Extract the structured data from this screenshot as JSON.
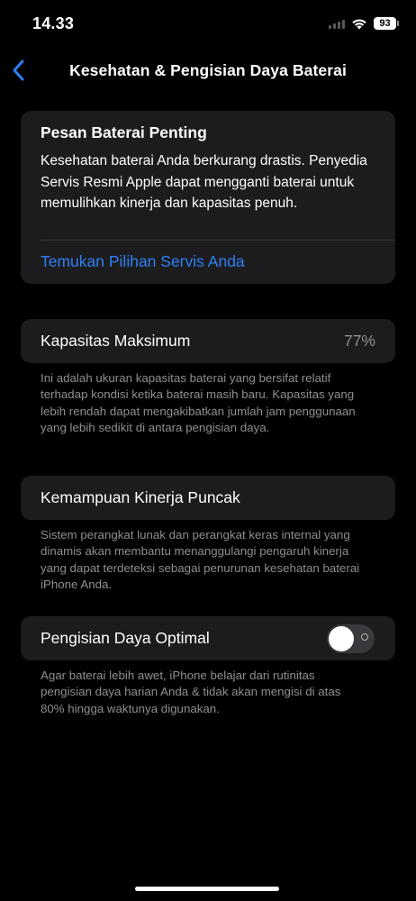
{
  "status_bar": {
    "time": "14.33",
    "battery_level": "93",
    "signal_icon": "cellular-signal-icon",
    "wifi_icon": "wifi-icon"
  },
  "nav": {
    "title": "Kesehatan & Pengisian Daya Baterai",
    "back_icon": "chevron-left-icon"
  },
  "important_message": {
    "title": "Pesan Baterai Penting",
    "body": "Kesehatan baterai Anda berkurang drastis. Penyedia Servis Resmi Apple dapat mengganti baterai untuk memulihkan kinerja dan kapasitas penuh.",
    "link": "Temukan Pilihan Servis Anda"
  },
  "max_capacity": {
    "label": "Kapasitas Maksimum",
    "value": "77%",
    "footnote": "Ini adalah ukuran kapasitas baterai yang bersifat relatif terhadap kondisi ketika baterai masih baru. Kapasitas yang lebih rendah dapat mengakibatkan jumlah jam penggunaan yang lebih sedikit di antara pengisian daya."
  },
  "peak_performance": {
    "label": "Kemampuan Kinerja Puncak",
    "footnote": "Sistem perangkat lunak dan perangkat keras internal yang dinamis akan membantu menanggulangi pengaruh kinerja yang dapat terdeteksi sebagai penurunan kesehatan baterai iPhone Anda."
  },
  "optimized_charging": {
    "label": "Pengisian Daya Optimal",
    "enabled": false,
    "footnote": "Agar baterai lebih awet, iPhone belajar dari rutinitas pengisian daya harian Anda & tidak akan mengisi di atas 80% hingga waktunya digunakan."
  },
  "colors": {
    "background": "#000000",
    "card": "#1c1c1e",
    "link": "#2f7ff5",
    "secondary_text": "#8e8e93"
  }
}
